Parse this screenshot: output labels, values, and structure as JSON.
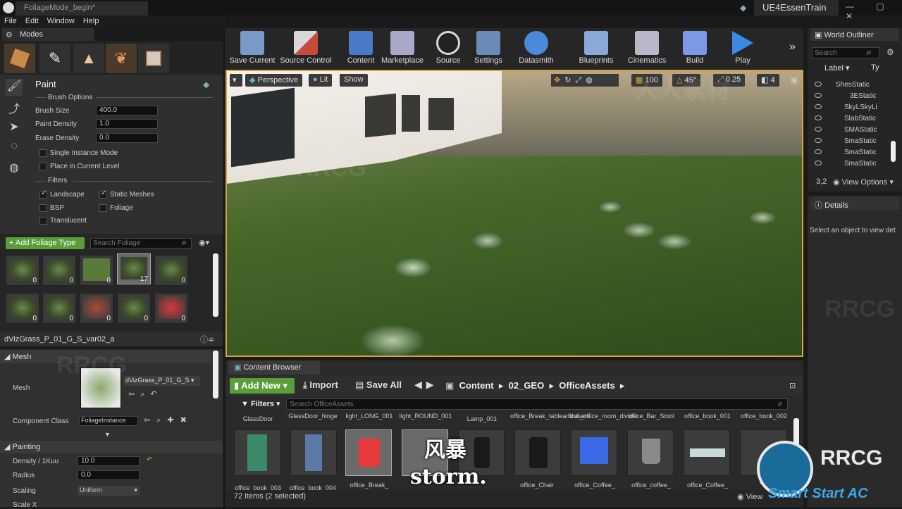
{
  "app": {
    "doc_tab": "FoliageMode_begin*",
    "project": "UE4EssenTrain",
    "window_controls": "— ▢ ✕"
  },
  "menu": [
    "File",
    "Edit",
    "Window",
    "Help"
  ],
  "modes": {
    "tab": "Modes",
    "panel_title": "Paint",
    "brush_options": "Brush Options",
    "brush_size_label": "Brush Size",
    "brush_size": "400.0",
    "paint_density_label": "Paint Density",
    "paint_density": "1.0",
    "erase_density_label": "Erase Density",
    "erase_density": "0.0",
    "single_instance": "Single Instance Mode",
    "place_current_level": "Place in Current Level",
    "filters_label": "Filters",
    "filters": {
      "landscape": "Landscape",
      "static_meshes": "Static Meshes",
      "bsp": "BSP",
      "foliage": "Foliage",
      "translucent": "Translucent"
    },
    "add_foliage_type": "+ Add Foliage Type",
    "search_foliage_placeholder": "Search Foliage",
    "foliage_counts": [
      "0",
      "0",
      "0",
      "17",
      "0",
      "0",
      "0",
      "0",
      "0",
      "0"
    ],
    "selected_foliage": "dVizGrass_P_01_G_S_var02_a",
    "mesh_section": "Mesh",
    "mesh_label": "Mesh",
    "mesh_value": "dVizGrass_P_01_G_S",
    "component_class_label": "Component Class",
    "component_class": "FoliageInstance",
    "painting_section": "Painting",
    "density_label": "Density / 1Kuu",
    "density": "10.0",
    "radius_label": "Radius",
    "radius": "0.0",
    "scaling_label": "Scaling",
    "scaling": "Uniform",
    "scale_x_label": "Scale X"
  },
  "toolbar": [
    {
      "label": "Save Current",
      "color": "#7a9ac8"
    },
    {
      "label": "Source Control",
      "color": "#c84a3a"
    },
    {
      "label": "Content",
      "color": "#4a7ac8"
    },
    {
      "label": "Marketplace",
      "color": "#a8a8c8"
    },
    {
      "label": "Source",
      "color": "#d8d8d8"
    },
    {
      "label": "Settings",
      "color": "#6a8ab8"
    },
    {
      "label": "Datasmith",
      "color": "#4a8ad8"
    },
    {
      "label": "Blueprints",
      "color": "#8aa8d8"
    },
    {
      "label": "Cinematics",
      "color": "#b8b8c8"
    },
    {
      "label": "Build",
      "color": "#7a9ae8"
    },
    {
      "label": "Play",
      "color": "#3a8ae8"
    }
  ],
  "viewport": {
    "perspective": "Perspective",
    "lit": "Lit",
    "show": "Show",
    "grid_snap": "100",
    "rot_snap": "45°",
    "scale_snap": "0.25",
    "cam_speed": "4"
  },
  "content_browser": {
    "tab": "Content Browser",
    "add_new": "Add New",
    "import": "Import",
    "save_all": "Save All",
    "path": [
      "Content",
      "02_GEO",
      "OfficeAssets"
    ],
    "filters": "Filters",
    "search_placeholder": "Search OfficeAssets",
    "top_names": [
      "GlassDoor",
      "GlassDoor_hinge",
      "light_LONG_001",
      "light_ROUND_001",
      "Lamp_001",
      "office_Break_tableandchairs",
      "final_office_room_divider",
      "office_Bar_Stool",
      "office_book_001",
      "office_book_002"
    ],
    "bottom_names": [
      "office_book_003",
      "office_book_004",
      "office_Break_",
      "",
      "",
      "office_Chair",
      "office_Coffee_",
      "office_coffee_",
      "office_Coffee_",
      "offi"
    ],
    "status": "72 items (2 selected)",
    "view_label": "View"
  },
  "outliner": {
    "tab": "World Outliner",
    "search_placeholder": "Search",
    "col_label": "Label",
    "col_type": "Ty",
    "rows": [
      "ShesStatic",
      "3EStatic",
      "SkyLSkyLi",
      "SlabStatic",
      "SMAStatic",
      "SmaStatic",
      "SmaStatic",
      "SmaStatic"
    ],
    "count": "3,2",
    "view_options": "View Options"
  },
  "details": {
    "tab": "Details",
    "empty": "Select an object to view det"
  },
  "subtitle": {
    "cn": "风暴",
    "en": "storm."
  },
  "watermarks": {
    "rrcg": "RRCG",
    "brand": "人人素材",
    "overlay": "Smart Start AC"
  }
}
